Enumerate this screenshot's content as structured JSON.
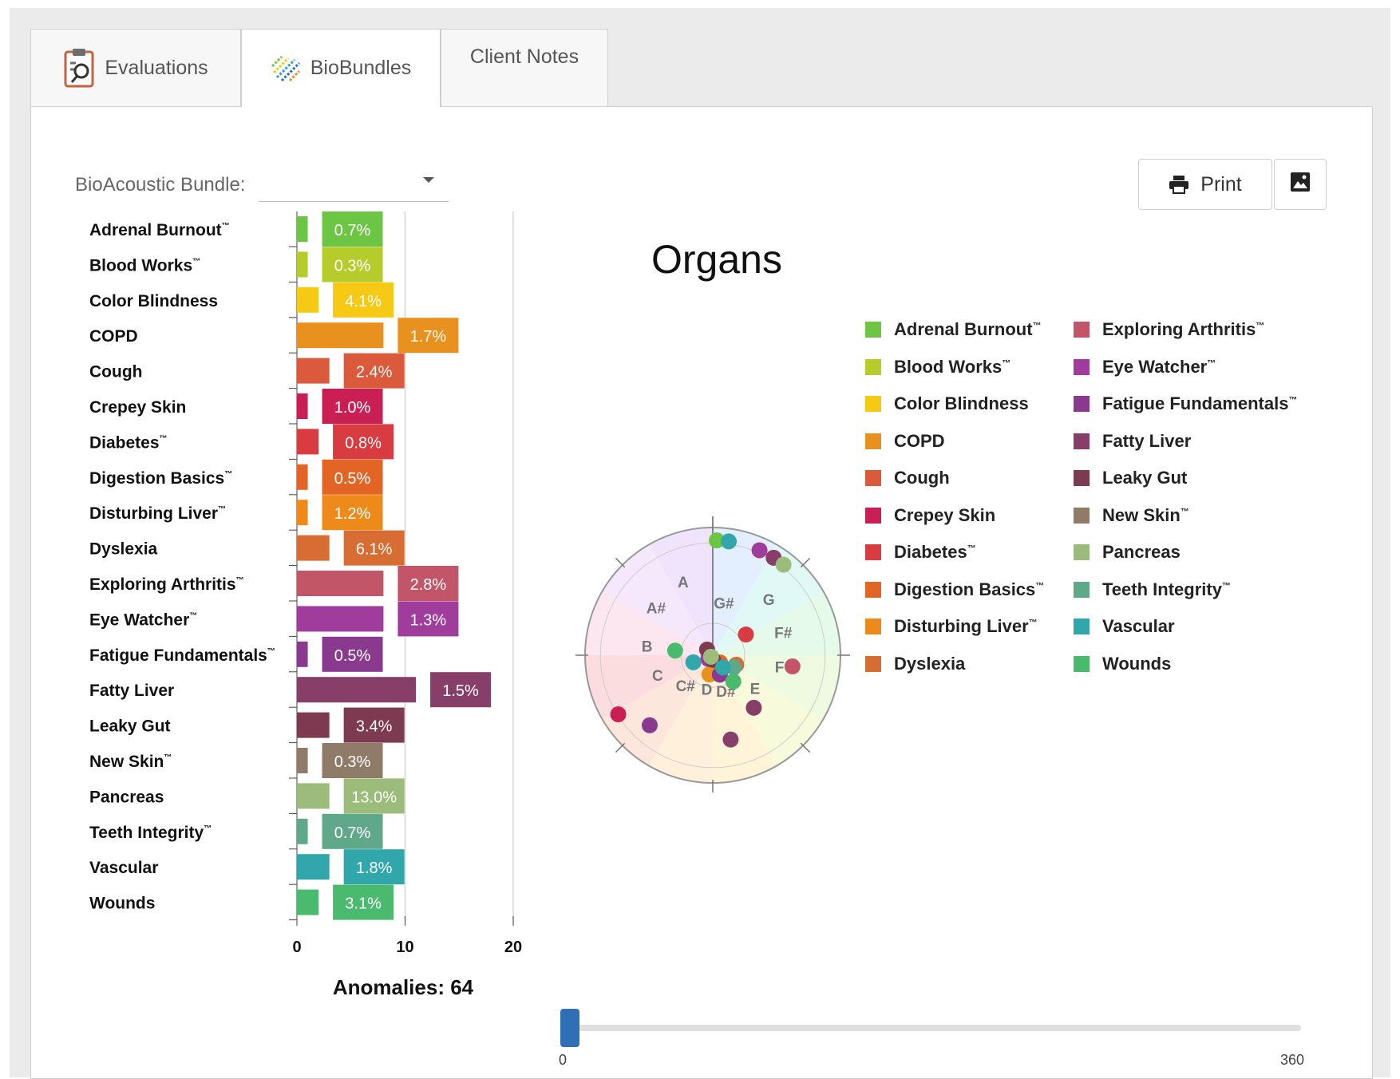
{
  "tabs": [
    {
      "label": "Evaluations",
      "icon": "clipboard-search-icon",
      "active": false
    },
    {
      "label": "BioBundles",
      "icon": "biobundles-icon",
      "active": true
    },
    {
      "label": "Client Notes",
      "icon": "",
      "active": false
    }
  ],
  "toolbar": {
    "bundle_label": "BioAcoustic Bundle:",
    "bundle_value": "",
    "print_label": "Print",
    "print_icon": "printer-icon",
    "image_icon": "image-icon"
  },
  "bar_chart": {
    "anomalies_text": "Anomalies: 64",
    "x_ticks": [
      "0",
      "10",
      "20"
    ]
  },
  "chart_title": "Organs",
  "slider": {
    "min_label": "0",
    "max_label": "360",
    "value": 0
  },
  "chart_data": [
    {
      "type": "bar",
      "orientation": "horizontal",
      "xlim": [
        0,
        20
      ],
      "x_ticks": [
        0,
        10,
        20
      ],
      "categories": [
        "Adrenal Burnout™",
        "Blood Works™",
        "Color Blindness",
        "COPD",
        "Cough",
        "Crepey Skin",
        "Diabetes™",
        "Digestion Basics™",
        "Disturbing Liver™",
        "Dyslexia",
        "Exploring Arthritis™",
        "Eye Watcher™",
        "Fatigue Fundamentals™",
        "Fatty Liver",
        "Leaky Gut",
        "New Skin™",
        "Pancreas",
        "Teeth Integrity™",
        "Vascular",
        "Wounds"
      ],
      "values": [
        1,
        1,
        2,
        8,
        3,
        1,
        2,
        1,
        1,
        3,
        8,
        8,
        1,
        11,
        3,
        1,
        3,
        1,
        3,
        2
      ],
      "labels": [
        "0.7%",
        "0.3%",
        "4.1%",
        "1.7%",
        "2.4%",
        "1.0%",
        "0.8%",
        "0.5%",
        "1.2%",
        "6.1%",
        "2.8%",
        "1.3%",
        "0.5%",
        "1.5%",
        "3.4%",
        "0.3%",
        "13.0%",
        "0.7%",
        "1.8%",
        "3.1%"
      ],
      "colors": [
        "#6cc644",
        "#b5cc2a",
        "#f6c915",
        "#e8911f",
        "#dc5a3c",
        "#c91f55",
        "#d93c40",
        "#e36525",
        "#ee8a1a",
        "#d86d34",
        "#c35569",
        "#a03c9c",
        "#8a3a8e",
        "#873f6a",
        "#7d3a50",
        "#8f7b68",
        "#9cbc7c",
        "#5fa88a",
        "#32a7ab",
        "#4aba6e"
      ]
    },
    {
      "type": "scatter",
      "subtype": "polar",
      "title": "Organs",
      "angle_axis": [
        "A",
        "A#",
        "B",
        "C",
        "C#",
        "D",
        "D#",
        "E",
        "F",
        "F#",
        "G",
        "G#"
      ],
      "series": [
        {
          "name": "Adrenal Burnout™",
          "color": "#6cc644",
          "points": [
            [
              2,
              1.0
            ]
          ]
        },
        {
          "name": "Blood Works™",
          "color": "#b5cc2a",
          "points": []
        },
        {
          "name": "Color Blindness",
          "color": "#f6c915",
          "points": []
        },
        {
          "name": "COPD",
          "color": "#e8911f",
          "points": [
            [
              190,
              0.17
            ]
          ]
        },
        {
          "name": "Cough",
          "color": "#dc5a3c",
          "points": []
        },
        {
          "name": "Crepey Skin",
          "color": "#c91f55",
          "points": [
            [
              238,
              0.97
            ]
          ]
        },
        {
          "name": "Diabetes™",
          "color": "#d93c40",
          "points": [
            [
              58,
              0.34
            ]
          ]
        },
        {
          "name": "Digestion Basics™",
          "color": "#e36525",
          "points": [
            [
              135,
              0.09
            ]
          ]
        },
        {
          "name": "Disturbing Liver™",
          "color": "#ee8a1a",
          "points": []
        },
        {
          "name": "Dyslexia",
          "color": "#d86d34",
          "points": [
            [
              112,
              0.22
            ]
          ]
        },
        {
          "name": "Exploring Arthritis™",
          "color": "#c35569",
          "points": [
            [
              98,
              0.7
            ]
          ]
        },
        {
          "name": "Eye Watcher™",
          "color": "#a03c9c",
          "points": [
            [
              24,
              1.0
            ],
            [
              230,
              0.05
            ]
          ]
        },
        {
          "name": "Fatigue Fundamentals™",
          "color": "#8a3a8e",
          "points": [
            [
              222,
              0.82
            ],
            [
              160,
              0.18
            ]
          ]
        },
        {
          "name": "Fatty Liver",
          "color": "#873f6a",
          "points": [
            [
              32,
              1.0
            ],
            [
              142,
              0.58
            ],
            [
              168,
              0.75
            ]
          ]
        },
        {
          "name": "Leaky Gut",
          "color": "#7d3a50",
          "points": [
            [
              315,
              0.07
            ],
            [
              178,
              0.04
            ]
          ]
        },
        {
          "name": "New Skin™",
          "color": "#8f7b68",
          "points": []
        },
        {
          "name": "Pancreas",
          "color": "#9cbc7c",
          "points": [
            [
              38,
              1.0
            ],
            [
              230,
              0.02
            ]
          ]
        },
        {
          "name": "Teeth Integrity™",
          "color": "#5fa88a",
          "points": [
            [
              120,
              0.21
            ]
          ]
        },
        {
          "name": "Vascular",
          "color": "#32a7ab",
          "points": [
            [
              8,
              1.0
            ],
            [
              250,
              0.18
            ],
            [
              140,
              0.14
            ]
          ]
        },
        {
          "name": "Wounds",
          "color": "#4aba6e",
          "points": [
            [
              277,
              0.33
            ],
            [
              142,
              0.29
            ]
          ]
        }
      ]
    }
  ]
}
